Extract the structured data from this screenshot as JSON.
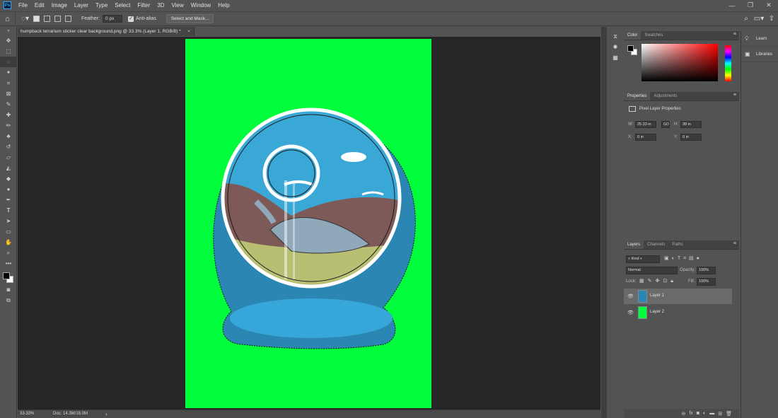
{
  "app": {
    "logo_text": "Ps",
    "menu": [
      "File",
      "Edit",
      "Image",
      "Layer",
      "Type",
      "Select",
      "Filter",
      "3D",
      "View",
      "Window",
      "Help"
    ],
    "window_controls": [
      "—",
      "❐",
      "✕"
    ]
  },
  "options_bar": {
    "feather_label": "Feather:",
    "feather_value": "0 px",
    "anti_alias_label": "Anti-alias",
    "anti_alias_checked": true,
    "select_mask_label": "Select and Mask..."
  },
  "document": {
    "tab_title": "humpback terrarium sticker clear background.png @ 33.3% (Layer 1, RGB/8) *",
    "close": "×",
    "zoom": "33.33%",
    "doc_info": "Doc: 14.3M/18.0M",
    "canvas_color": "#00fe3d"
  },
  "color_panel": {
    "tabs": [
      "Color",
      "Swatches"
    ],
    "foreground": "#000000",
    "background": "#ffffff",
    "picker_hue": "#ff0000"
  },
  "properties_panel": {
    "tabs": [
      "Properties",
      "Adjustments"
    ],
    "section": "Pixel Layer Properties",
    "w_label": "W:",
    "w_value": "25.33 in",
    "h_label": "H:",
    "h_value": "38 in",
    "x_label": "X:",
    "x_value": "0 in",
    "y_label": "Y:",
    "y_value": "0 in",
    "link_icon": "GO"
  },
  "layers_panel": {
    "tabs": [
      "Layers",
      "Channels",
      "Paths"
    ],
    "filter_label": "Kind",
    "blend_mode": "Normal",
    "opacity_label": "Opacity:",
    "opacity_value": "100%",
    "lock_label": "Lock:",
    "fill_label": "Fill:",
    "fill_value": "100%",
    "layers": [
      {
        "name": "Layer 1",
        "selected": true,
        "thumb": "#2a87b4"
      },
      {
        "name": "Layer 2",
        "selected": false,
        "thumb": "#00fe3d"
      }
    ]
  },
  "right_dock": {
    "items": [
      "Learn",
      "Libraries"
    ]
  }
}
